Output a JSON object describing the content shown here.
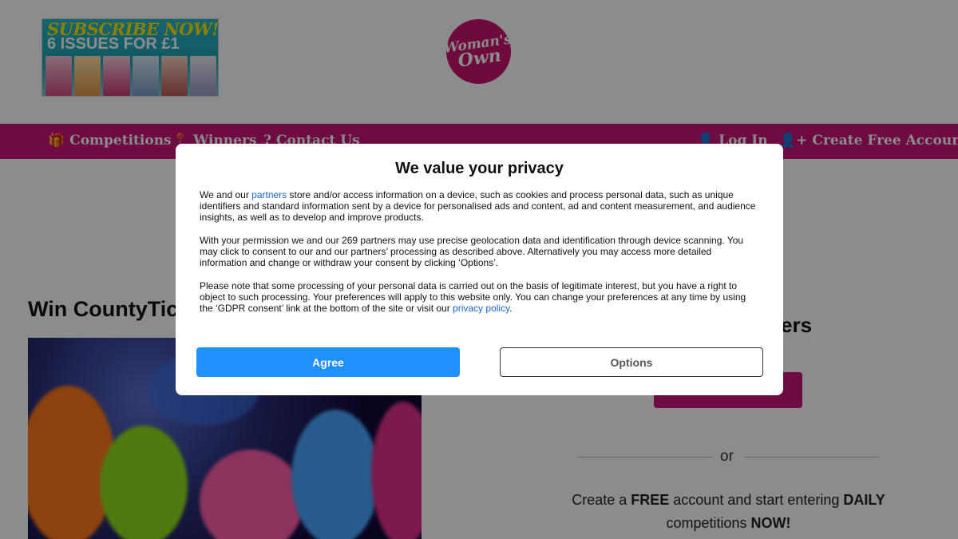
{
  "header": {
    "subscribe_line1": "SUBSCRIBE NOW!",
    "subscribe_line2": "6 ISSUES FOR £1",
    "logo_text_1": "Woman's",
    "logo_text_2": "Own"
  },
  "nav": {
    "items": [
      {
        "label": "Competitions",
        "icon": "gift-icon"
      },
      {
        "label": "Winners",
        "icon": "map-pin-icon"
      },
      {
        "label": "Contact Us",
        "icon": "question-icon"
      },
      {
        "label": "Log In",
        "icon": "user-icon"
      },
      {
        "label": "Create Free Account",
        "icon": "user-plus-icon"
      }
    ]
  },
  "main": {
    "title": "Win CountyTic",
    "side_heading": "ers",
    "or_text": "or",
    "promo": {
      "part1": "Create a ",
      "free": "FREE",
      "part2": " account and start entering ",
      "daily": "DAILY",
      "part3": " competitions ",
      "now": "NOW!"
    }
  },
  "consent": {
    "title": "We value your privacy",
    "p1_before_link": "We and our ",
    "p1_link": "partners",
    "p1_after_link": " store and/or access information on a device, such as cookies and process personal data, such as unique identifiers and standard information sent by a device for personalised ads and content, ad and content measurement, and audience insights, as well as to develop and improve products.",
    "p2": "With your permission we and our 269 partners may use precise geolocation data and identification through device scanning. You may click to consent to our and our partners’ processing as described above. Alternatively you may access more detailed information and change or withdraw your consent by clicking ‘Options’.",
    "p3_before_link": "Please note that some processing of your personal data is carried out on the basis of legitimate interest, but you have a right to object to such processing. Your preferences will apply to this website only. You can change your preferences at any time by using the ‘GDPR consent’ link at the bottom of the site or visit our ",
    "p3_link": "privacy policy",
    "p3_after_link": ".",
    "agree_label": "Agree",
    "options_label": "Options"
  },
  "colors": {
    "brand_magenta": "#c8147a",
    "agree_blue": "#1e90ff",
    "link_blue": "#1a66c8"
  }
}
